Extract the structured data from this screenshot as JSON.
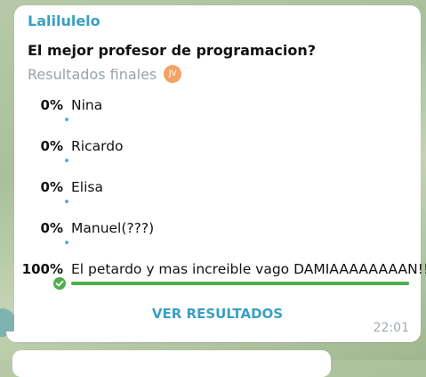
{
  "message": {
    "sender": "Lalilulelo",
    "time": "22:01"
  },
  "poll": {
    "question": "El mejor profesor de programacion?",
    "subtitle": "Resultados finales",
    "voter_initials": "JV",
    "options": [
      {
        "percent_label": "0%",
        "label": "Nina",
        "percent": 0,
        "winner": false
      },
      {
        "percent_label": "0%",
        "label": "Ricardo",
        "percent": 0,
        "winner": false
      },
      {
        "percent_label": "0%",
        "label": "Elisa",
        "percent": 0,
        "winner": false
      },
      {
        "percent_label": "0%",
        "label": "Manuel(???)",
        "percent": 0,
        "winner": false
      },
      {
        "percent_label": "100%",
        "label": "El petardo y mas increible vago DAMIAAAAAAAAN!!!!",
        "percent": 100,
        "winner": true
      }
    ],
    "view_results_label": "VER RESULTADOS"
  },
  "colors": {
    "accent": "#3a9fc4",
    "bar_default": "#4bb2de",
    "bar_winner": "#4fae4e",
    "voter_avatar": "#f4a165"
  }
}
